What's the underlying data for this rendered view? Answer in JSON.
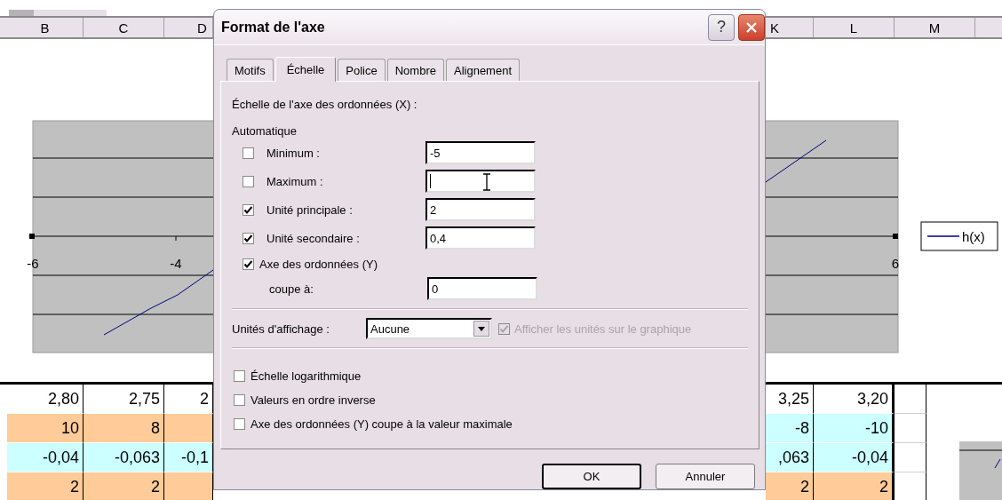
{
  "sheet": {
    "columns_left": [
      "B",
      "C",
      "D"
    ],
    "columns_right": [
      "K",
      "L",
      "M"
    ]
  },
  "chart": {
    "x_labels": [
      "-6",
      "-4",
      "6"
    ],
    "legend": "h(x)"
  },
  "table": {
    "rows": [
      {
        "left": [
          {
            "text": "2,80",
            "color": "#ffffff"
          },
          {
            "text": "2,75",
            "color": "#ffffff"
          },
          {
            "text": "2",
            "color": "#ffffff"
          }
        ],
        "right": [
          {
            "text": "3,25",
            "color": "#ffffff"
          },
          {
            "text": "3,20",
            "color": "#ffffff"
          }
        ]
      },
      {
        "left": [
          {
            "text": "10",
            "color": "#ffcc99"
          },
          {
            "text": "8",
            "color": "#ffcc99"
          },
          {
            "color": "#ffcc99"
          }
        ],
        "right": [
          {
            "text": "-8",
            "color": "#ccffff"
          },
          {
            "text": "-10",
            "color": "#ccffff"
          }
        ]
      },
      {
        "left": [
          {
            "text": "-0,04",
            "color": "#ccffff"
          },
          {
            "text": "-0,063",
            "color": "#ccffff"
          },
          {
            "text": "-0,1",
            "color": "#ccffff"
          }
        ],
        "right": [
          {
            "text": ",063",
            "color": "#ccffff"
          },
          {
            "text": "-0,04",
            "color": "#ccffff"
          }
        ]
      },
      {
        "left": [
          {
            "text": "2",
            "color": "#ffcc99"
          },
          {
            "text": "2",
            "color": "#ffcc99"
          },
          {
            "color": "#ffcc99"
          }
        ],
        "right": [
          {
            "text": "2",
            "color": "#ffcc99"
          },
          {
            "text": "2",
            "color": "#ffcc99"
          }
        ]
      }
    ]
  },
  "dialog": {
    "title": "Format de l'axe",
    "help": "?",
    "tabs": [
      {
        "label": "Motifs",
        "selected": false
      },
      {
        "label": "Échelle",
        "selected": true
      },
      {
        "label": "Police",
        "selected": false
      },
      {
        "label": "Nombre",
        "selected": false
      },
      {
        "label": "Alignement",
        "selected": false
      }
    ],
    "heading": "Échelle de l'axe des ordonnées (X) :",
    "group": "Automatique",
    "fields": [
      {
        "label": "Minimum :",
        "checked": false,
        "value": "-5",
        "focused": false
      },
      {
        "label": "Maximum :",
        "checked": false,
        "focused": true
      },
      {
        "label": "Unité principale :",
        "checked": true,
        "value": "2",
        "focused": false
      },
      {
        "label": "Unité secondaire :",
        "checked": true,
        "value": "0,4",
        "focused": false
      }
    ],
    "axis_cross": {
      "label": "Axe des ordonnées (Y)",
      "checked": true
    },
    "crosses_at": {
      "label": "coupe à:",
      "value": "0"
    },
    "display_units": {
      "label": "Unités d'affichage :",
      "value": "Aucune"
    },
    "show_units": {
      "label": "Afficher les unités sur le graphique",
      "checked": true,
      "disabled": true
    },
    "options": [
      {
        "label": "Échelle logarithmique",
        "checked": false
      },
      {
        "label": "Valeurs en ordre inverse",
        "checked": false
      },
      {
        "label": "Axe des ordonnées (Y) coupe à la valeur maximale",
        "checked": false
      }
    ],
    "buttons": [
      {
        "label": "OK",
        "default": true
      },
      {
        "label": "Annuler",
        "default": false
      }
    ]
  }
}
